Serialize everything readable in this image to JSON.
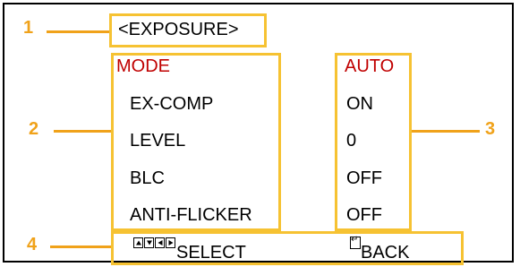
{
  "menu": {
    "title": "<EXPOSURE>",
    "items": [
      {
        "label": "MODE",
        "value": "AUTO",
        "selected": true
      },
      {
        "label": "EX-COMP",
        "value": "ON",
        "selected": false
      },
      {
        "label": "LEVEL",
        "value": "0",
        "selected": false
      },
      {
        "label": "BLC",
        "value": "OFF",
        "selected": false
      },
      {
        "label": "ANTI-FLICKER",
        "value": "OFF",
        "selected": false
      }
    ],
    "footer": {
      "select_label": "SELECT",
      "back_label": "BACK"
    }
  },
  "callouts": [
    "1",
    "2",
    "3",
    "4"
  ],
  "colors": {
    "highlight_box": "#f6c232",
    "callout": "#f0a21a",
    "selected_text": "#c00000"
  },
  "icons": [
    "up-arrow-key-icon",
    "down-arrow-key-icon",
    "left-arrow-key-icon",
    "right-arrow-key-icon",
    "back-enter-icon"
  ]
}
